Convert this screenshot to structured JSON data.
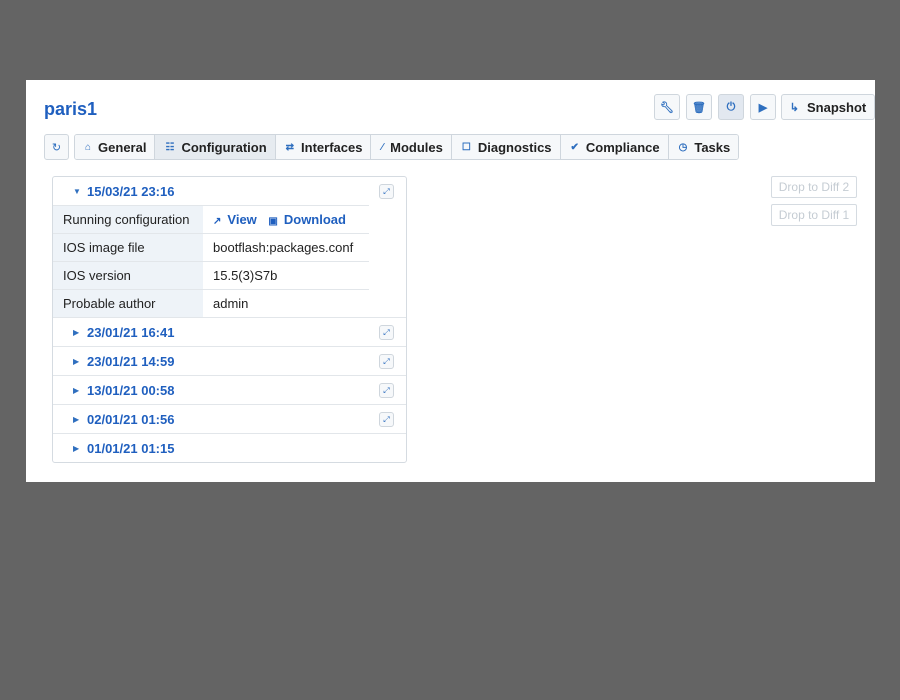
{
  "device": {
    "name": "paris1"
  },
  "actions": {
    "configure_icon": "wrench-icon",
    "delete_icon": "trash-icon",
    "power_icon": "power-icon",
    "run_icon": "play-icon",
    "snapshot_label": "Snapshot",
    "snapshot_icon": "arrow-curve-icon"
  },
  "tabs": [
    {
      "label": "General",
      "icon": "home-icon"
    },
    {
      "label": "Configuration",
      "icon": "database-icon",
      "active": true
    },
    {
      "label": "Interfaces",
      "icon": "exchange-icon"
    },
    {
      "label": "Modules",
      "icon": "link-icon"
    },
    {
      "label": "Diagnostics",
      "icon": "clipboard-icon"
    },
    {
      "label": "Compliance",
      "icon": "check-icon"
    },
    {
      "label": "Tasks",
      "icon": "clock-icon"
    }
  ],
  "history": {
    "expanded": {
      "date": "15/03/21 23:16",
      "running_config_label": "Running configuration",
      "view_label": "View",
      "download_label": "Download",
      "ios_image_label": "IOS image file",
      "ios_image_value": "bootflash:packages.conf",
      "ios_version_label": "IOS version",
      "ios_version_value": "15.5(3)S7b",
      "author_label": "Probable author",
      "author_value": "admin"
    },
    "collapsed": [
      {
        "date": "23/01/21 16:41"
      },
      {
        "date": "23/01/21 14:59"
      },
      {
        "date": "13/01/21 00:58"
      },
      {
        "date": "02/01/21 01:56"
      },
      {
        "date": "01/01/21 01:15"
      }
    ]
  },
  "diff": {
    "drop2": "Drop to Diff 2",
    "drop1": "Drop to Diff 1"
  },
  "colors": {
    "accent": "#1f5fbf",
    "background": "#646464"
  }
}
